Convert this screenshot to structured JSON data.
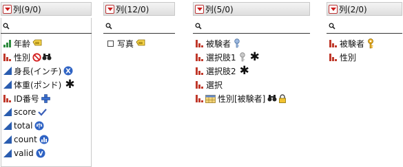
{
  "panels": [
    {
      "title": "列(9/0)",
      "items": [
        {
          "label": "年齢",
          "type": "ordinal",
          "badges": [
            "label-tag-icon"
          ]
        },
        {
          "label": "性別",
          "type": "nominal",
          "badges": [
            "no-entry-icon",
            "binoculars-icon"
          ]
        },
        {
          "label": "身長(インチ)",
          "type": "continuous",
          "badges": [
            "x-role-icon"
          ]
        },
        {
          "label": "体重(ポンド)",
          "type": "continuous",
          "badges": [
            "asterisk-icon"
          ]
        },
        {
          "label": "ID番号",
          "type": "nominal",
          "badges": [
            "plus-icon"
          ]
        },
        {
          "label": "score",
          "type": "continuous",
          "badges": [
            "checkmark-icon"
          ]
        },
        {
          "label": "total",
          "type": "continuous",
          "badges": [
            "scale-icon"
          ]
        },
        {
          "label": "count",
          "type": "continuous",
          "badges": [
            "frequency-icon"
          ]
        },
        {
          "label": "valid",
          "type": "continuous",
          "badges": [
            "validation-icon"
          ]
        }
      ]
    },
    {
      "title": "列(12/0)",
      "items": [
        {
          "label": "写真",
          "type": "expression",
          "badges": [
            "label-tag-icon"
          ]
        }
      ]
    },
    {
      "title": "列(5/0)",
      "items": [
        {
          "label": "被験者",
          "type": "nominal",
          "badges": [
            "link-id-icon"
          ]
        },
        {
          "label": "選択肢1",
          "type": "nominal",
          "badges": [
            "link-id-icon",
            "asterisk-icon"
          ]
        },
        {
          "label": "選択肢2",
          "type": "nominal",
          "badges": [
            "asterisk-icon"
          ]
        },
        {
          "label": "選択",
          "type": "nominal",
          "badges": []
        },
        {
          "label": "性別[被験者]",
          "type": "nominal-linked",
          "badges": [
            "binoculars-icon",
            "lock-icon"
          ]
        }
      ]
    },
    {
      "title": "列(2/0)",
      "items": [
        {
          "label": "被験者",
          "type": "nominal",
          "badges": [
            "key-icon"
          ]
        },
        {
          "label": "性別",
          "type": "nominal",
          "badges": []
        }
      ]
    }
  ],
  "colors": {
    "nominal": "#c0392b",
    "ordinal": "#2e8b3e",
    "continuous": "#2a5db0",
    "menu_triangle": "#cc1d1d"
  }
}
